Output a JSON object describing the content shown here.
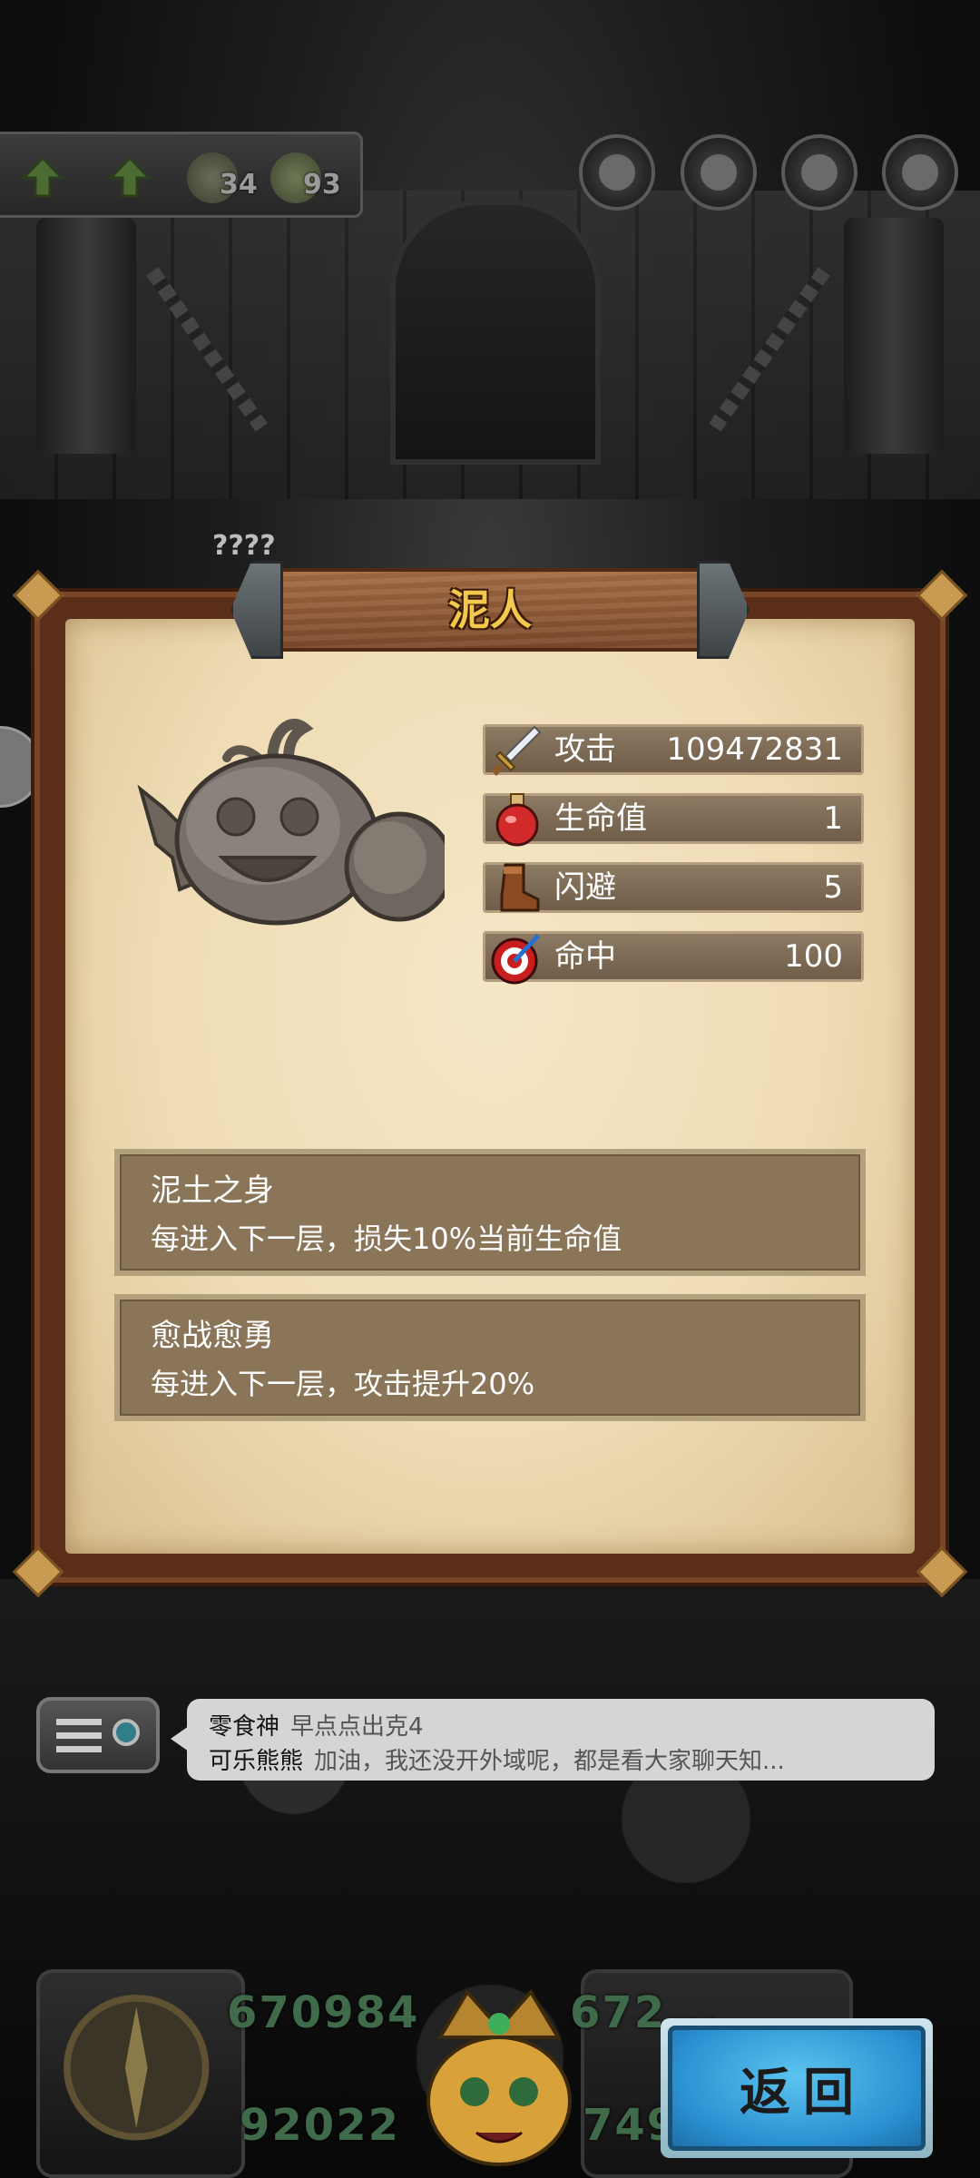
{
  "topbar": {
    "resources": [
      {
        "icon": "spiral-icon",
        "value": "34"
      },
      {
        "icon": "gear-bag-icon",
        "value": "93"
      }
    ],
    "circle_buttons": [
      "character-avatar-1-icon",
      "character-avatar-2-icon",
      "character-avatar-3-icon",
      "character-avatar-4-icon"
    ]
  },
  "unknown_label": "????",
  "panel": {
    "title": "泥人",
    "stats": [
      {
        "icon": "sword-icon",
        "label": "攻击",
        "value": "109472831"
      },
      {
        "icon": "potion-icon",
        "label": "生命值",
        "value": "1"
      },
      {
        "icon": "boot-icon",
        "label": "闪避",
        "value": "5"
      },
      {
        "icon": "target-icon",
        "label": "命中",
        "value": "100"
      }
    ],
    "skills": [
      {
        "name": "泥土之身",
        "desc": "每进入下一层，损失10%当前生命值"
      },
      {
        "name": "愈战愈勇",
        "desc": "每进入下一层，攻击提升20%"
      }
    ]
  },
  "chat": {
    "lines": [
      {
        "user": "零食神",
        "message": "早点点出克4"
      },
      {
        "user": "可乐熊熊",
        "message": "加油，我还没开外域呢，都是看大家聊天知..."
      }
    ]
  },
  "hud": {
    "numbers": [
      "670984",
      "672...",
      "92022",
      "749..."
    ]
  },
  "back_button": {
    "label": "返回"
  },
  "colors": {
    "title_gold": "#f2c94c",
    "stat_bar": "#7d6a55",
    "skill_box": "#8a7559",
    "parchment": "#efdcb5",
    "back_blue": "#2a8fd0"
  }
}
